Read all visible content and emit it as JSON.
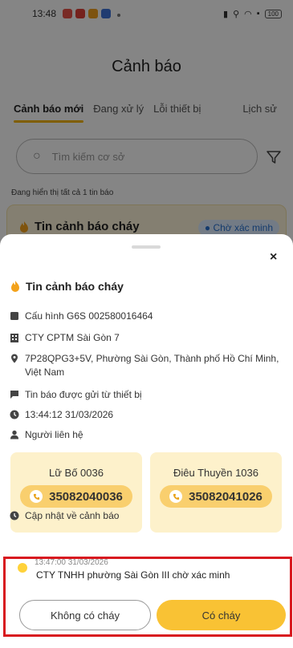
{
  "status_bar": {
    "time": "13:48",
    "battery": "100"
  },
  "header": {
    "title": "Cảnh báo"
  },
  "tabs": [
    {
      "label": "Cảnh báo mới"
    },
    {
      "label": "Đang xử lý"
    },
    {
      "label": "Lỗi thiết bị"
    },
    {
      "label": "Lịch sử"
    }
  ],
  "search": {
    "placeholder": "Tìm kiếm cơ sở"
  },
  "list_summary": "Đang hiển thị tất cả 1 tin báo",
  "alert_card": {
    "title": "Tin cảnh báo cháy",
    "status": "Chờ xác minh"
  },
  "sheet": {
    "close": "×",
    "title": "Tin cảnh báo cháy",
    "config": "Cấu hình G6S 002580016464",
    "company": "CTY CPTM Sài Gòn 7",
    "address": "7P28QPG3+5V, Phường Sài Gòn, Thành phố Hồ Chí Minh, Việt Nam",
    "source": "Tin báo được gửi từ thiết bị",
    "datetime": "13:44:12 31/03/2026",
    "contact_label": "Người liên hệ",
    "contacts": [
      {
        "name": "Lữ Bố 0036",
        "phone": "35082040036"
      },
      {
        "name": "Điêu Thuyền 1036",
        "phone": "35082041026"
      }
    ],
    "updates_label": "Cập nhật về cảnh báo",
    "update": {
      "time": "13:47:00 31/03/2026",
      "text": "CTY TNHH phường Sài Gòn III chờ xác minh"
    },
    "btn_no": "Không có cháy",
    "btn_yes": "Có cháy"
  },
  "colors": {
    "accent": "#f9c234",
    "highlight": "#d8191f",
    "badge_blue": "#2770d0"
  }
}
